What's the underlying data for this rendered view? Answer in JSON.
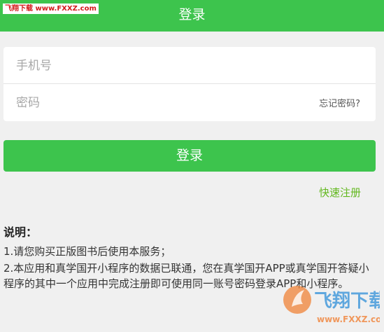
{
  "watermark_top": "飞翔下载 www.FXXZ.com",
  "header": {
    "title": "登录"
  },
  "form": {
    "phone_placeholder": "手机号",
    "password_placeholder": "密码",
    "forgot_label": "忘记密码?"
  },
  "login_button": "登录",
  "register_link": "快速注册",
  "notes": {
    "heading": "说明：",
    "items": [
      "1.请您购买正版图书后使用本服务；",
      "2.本应用和真学国开小程序的数据已联通，您在真学国开APP或真学国开答疑小程序的其中一个应用中完成注册即可使用同一账号密码登录APP和小程序。"
    ]
  },
  "watermark_logo": {
    "name": "飞翔下载",
    "url": "www.FXXZ.com"
  },
  "colors": {
    "primary": "#3dc44d",
    "link": "#62b81e",
    "background": "#f0f0f0"
  }
}
